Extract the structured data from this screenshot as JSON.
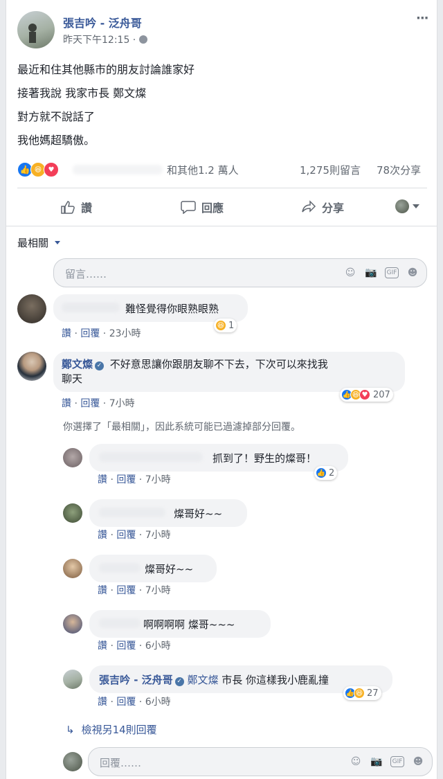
{
  "post": {
    "author": "張吉吟 - 泛舟哥",
    "time": "昨天下午12:15 · ",
    "more": "···",
    "lines": [
      "最近和住其他縣市的朋友討論誰家好",
      "接著我說 我家市長 鄭文燦",
      "對方就不說話了",
      "我他媽超驕傲。"
    ],
    "reaction_summary": "和其他1.2 萬人",
    "comments_count": "1,275則留言",
    "shares_count": "78次分享"
  },
  "actions": {
    "like": "讚",
    "comment": "回應",
    "share": "分享"
  },
  "sort": {
    "label": "最相關"
  },
  "comment_box": {
    "placeholder": "留言……"
  },
  "comments": [
    {
      "text": "難怪覺得你眼熟眼熟",
      "reactions": "1",
      "like": "讚",
      "reply": "回覆",
      "time": "23小時"
    },
    {
      "author": "鄭文燦",
      "text_1": "不好意思讓你跟朋友聊不下去，下次可以來找我",
      "text_2": "聊天",
      "reactions": "207",
      "like": "讚",
      "reply": "回覆",
      "time": "7小時"
    }
  ],
  "filter_note": "你選擇了「最相關」，因此系統可能已過濾掉部分回覆。",
  "replies": [
    {
      "text": "抓到了！野生的燦哥！",
      "reactions": "2",
      "like": "讚",
      "reply": "回覆",
      "time": "7小時"
    },
    {
      "text": "燦哥好~~",
      "like": "讚",
      "reply": "回覆",
      "time": "7小時"
    },
    {
      "text": "燦哥好~~",
      "like": "讚",
      "reply": "回覆",
      "time": "7小時"
    },
    {
      "text": "啊啊啊啊 燦哥~~~",
      "like": "讚",
      "reply": "回覆",
      "time": "6小時"
    },
    {
      "author": "張吉吟 - 泛舟哥",
      "mention": "鄭文燦",
      "text": " 市長 你這樣我小鹿亂撞",
      "reactions": "27",
      "like": "讚",
      "reply": "回覆",
      "time": "6小時"
    }
  ],
  "view_more": "檢視另14則回覆",
  "reply_box": {
    "placeholder": "回覆……"
  },
  "colors": {
    "link": "#385898",
    "like": "#1877f2",
    "haha": "#f7b125",
    "love": "#f33e58"
  }
}
